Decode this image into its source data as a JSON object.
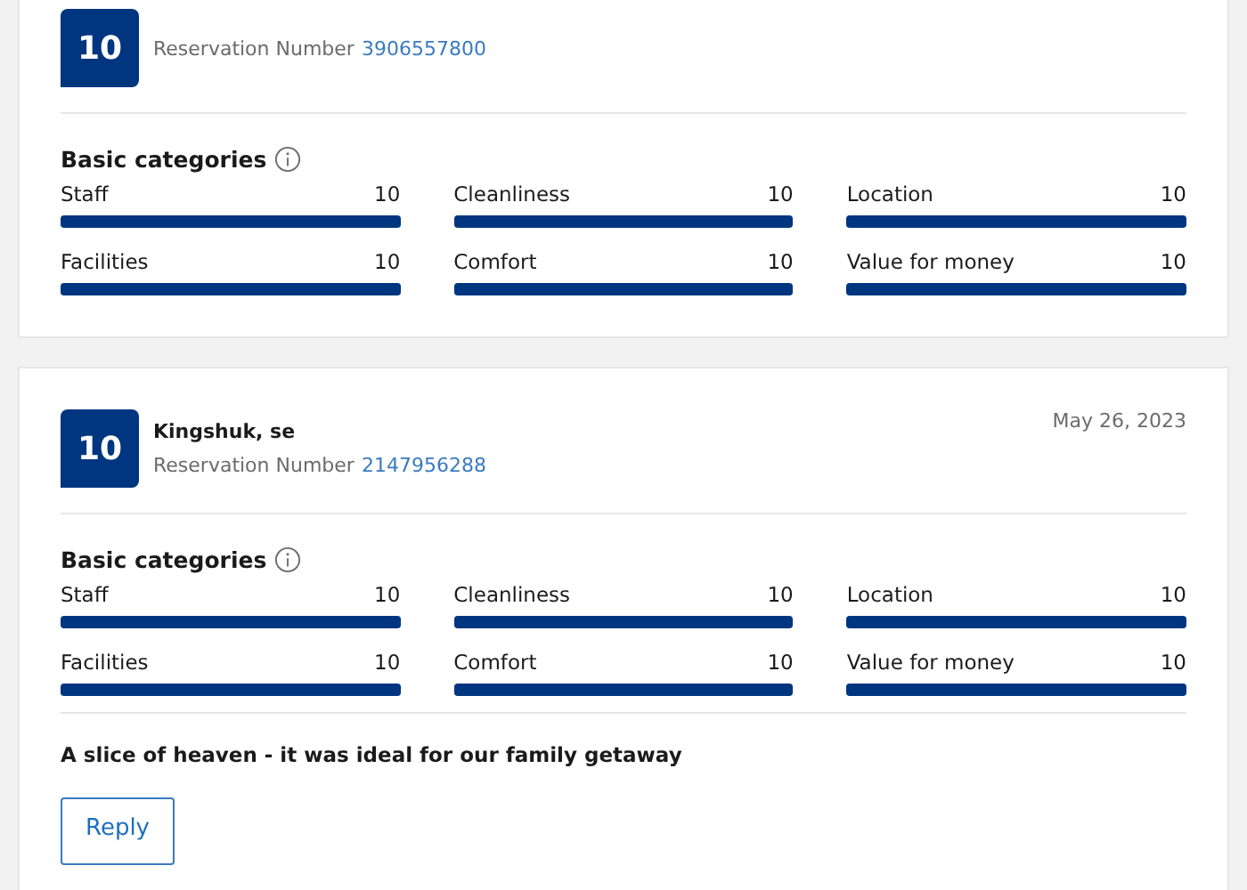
{
  "reviews": [
    {
      "score": "10",
      "reservation_label": "Reservation Number",
      "reservation_number": "3906557800",
      "categories_title": "Basic categories",
      "categories": [
        {
          "label": "Staff",
          "score": "10",
          "level": 1
        },
        {
          "label": "Cleanliness",
          "score": "10",
          "level": 1
        },
        {
          "label": "Location",
          "score": "10",
          "level": 1
        },
        {
          "label": "Facilities",
          "score": "10",
          "level": 1
        },
        {
          "label": "Comfort",
          "score": "10",
          "level": 1
        },
        {
          "label": "Value for money",
          "score": "10",
          "level": 1
        }
      ]
    },
    {
      "score": "10",
      "name": "Kingshuk, se",
      "date": "May 26, 2023",
      "reservation_label": "Reservation Number",
      "reservation_number": "2147956288",
      "categories_title": "Basic categories",
      "categories": [
        {
          "label": "Staff",
          "score": "10",
          "level": 1
        },
        {
          "label": "Cleanliness",
          "score": "10",
          "level": 1
        },
        {
          "label": "Location",
          "score": "10",
          "level": 1
        },
        {
          "label": "Facilities",
          "score": "10",
          "level": 1
        },
        {
          "label": "Comfort",
          "score": "10",
          "level": 1
        },
        {
          "label": "Value for money",
          "score": "10",
          "level": 1
        }
      ],
      "title": "A slice of heaven - it was ideal for our family getaway",
      "reply_button": "Reply"
    }
  ]
}
